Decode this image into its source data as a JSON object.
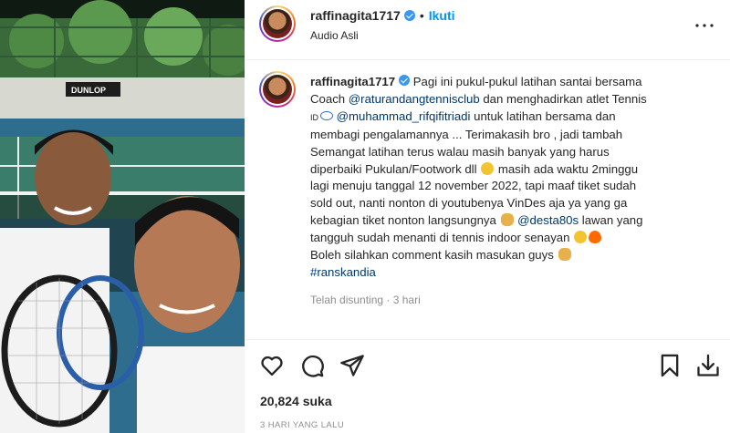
{
  "header": {
    "username": "raffinagita1717",
    "separator": "•",
    "follow_label": "Ikuti",
    "audio_label": "Audio Asli",
    "more_label": "•••"
  },
  "caption": {
    "username": "raffinagita1717",
    "text_1": "Pagi ini pukul-pukul latihan santai bersama",
    "text_2": "Coach ",
    "mention_coach": "@raturandangtennisclub",
    "text_3": " dan menghadirkan atlet Tennis",
    "text_4": "ID",
    "mention_athlete": "@muhammad_rifqifitriadi",
    "text_5": " untuk latihan bersama dan",
    "text_6": "membagi pengalamannya ... Terimakasih bro , jadi tambah",
    "text_7": "Semangat latihan terus walau masih banyak yang harus",
    "text_8": "diperbaiki Pukulan/Footwork dll",
    "text_9": " masih ada waktu 2minggu",
    "text_10": "lagi menuju tanggal 12 november 2022, tapi maaf tiket sudah",
    "text_11": "sold out, nanti nonton di youtubenya VinDes aja ya yang ga",
    "text_12": "kebagian tiket nonton langsungnya ",
    "mention_desta": "@desta80s",
    "text_13": " lawan yang",
    "text_14": "tangguh sudah menanti di tennis indoor senayan",
    "text_15": "Boleh silahkan comment kasih masukan guys",
    "hashtag": "#ranskandia"
  },
  "meta": {
    "edited": "Telah disunting",
    "separator": "·",
    "time": "3 hari"
  },
  "actions": {
    "icons": [
      "heart-icon",
      "comment-icon",
      "share-icon",
      "bookmark-icon",
      "download-icon"
    ]
  },
  "likes_label": "20,824 suka",
  "date_label": "3 HARI YANG LALU",
  "colors": {
    "link": "#00376b",
    "follow": "#0095f6",
    "verified": "#3897f0",
    "muted": "#8e8e8e"
  }
}
